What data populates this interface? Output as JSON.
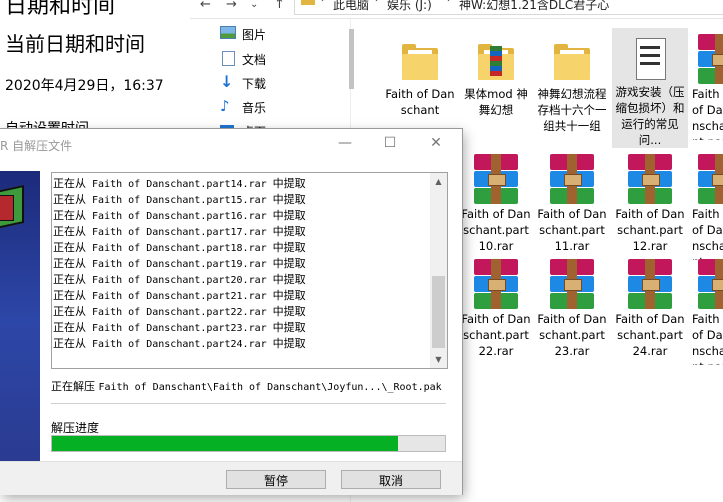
{
  "settings": {
    "title": "日期和时间",
    "heading": "当前日期和时间",
    "current_datetime": "2020年4月29日，16:37",
    "auto_set_label": "自动设置时间"
  },
  "explorer": {
    "path": [
      "此电脑",
      "娱乐 (J:)",
      "神W:幻想1.21含DLC君子心"
    ],
    "nav_back": "←",
    "nav_forward": "→",
    "nav_up": "↑",
    "nav_items": [
      {
        "label": "图片",
        "icon": "pictures-icon"
      },
      {
        "label": "文档",
        "icon": "documents-icon"
      },
      {
        "label": "下载",
        "icon": "downloads-icon"
      },
      {
        "label": "音乐",
        "icon": "music-icon"
      },
      {
        "label": "桌面",
        "icon": "desktop-icon"
      }
    ],
    "tiles_top": [
      {
        "label": "Faith of Danschant",
        "type": "folder"
      },
      {
        "label": "果体mod 神舞幻想",
        "type": "folder-striped"
      },
      {
        "label": "神舞幻想流程存档十六个一组共十一组",
        "type": "folder"
      },
      {
        "label": "游戏安装（压缩包损坏）和运行的常见问...",
        "type": "document"
      },
      {
        "label": "Faith of Danschant.part...",
        "type": "archive"
      }
    ],
    "tiles_mid": [
      {
        "label": "Faith of Danschant.part10.rar"
      },
      {
        "label": "Faith of Danschant.part11.rar"
      },
      {
        "label": "Faith of Danschant.part12.rar"
      },
      {
        "label": "Faith of Danschant.part..."
      }
    ],
    "tiles_bottom": [
      {
        "label": "Faith of Danschant.part22.rar"
      },
      {
        "label": "Faith of Danschant.part23.rar"
      },
      {
        "label": "Faith of Danschant.part24.rar"
      },
      {
        "label": "Faith of Danschant.part..."
      }
    ]
  },
  "dialog": {
    "title": "R 自解压文件",
    "minimize": "—",
    "maximize": "☐",
    "close": "✕",
    "log_prefix": "正在从",
    "log_suffix": "中提取",
    "log_files": [
      "Faith of Danschant.part14.rar",
      "Faith of Danschant.part15.rar",
      "Faith of Danschant.part16.rar",
      "Faith of Danschant.part17.rar",
      "Faith of Danschant.part18.rar",
      "Faith of Danschant.part19.rar",
      "Faith of Danschant.part20.rar",
      "Faith of Danschant.part21.rar",
      "Faith of Danschant.part22.rar",
      "Faith of Danschant.part23.rar",
      "Faith of Danschant.part24.rar"
    ],
    "current_prefix": "正在解压",
    "current_file": "Faith of Danschant\\Faith of Danschant\\Joyfun...\\_Root.pak",
    "progress_label": "解压进度",
    "progress_fraction": 0.88,
    "pause_label": "暂停",
    "cancel_label": "取消",
    "progress_color": "#06b025"
  }
}
